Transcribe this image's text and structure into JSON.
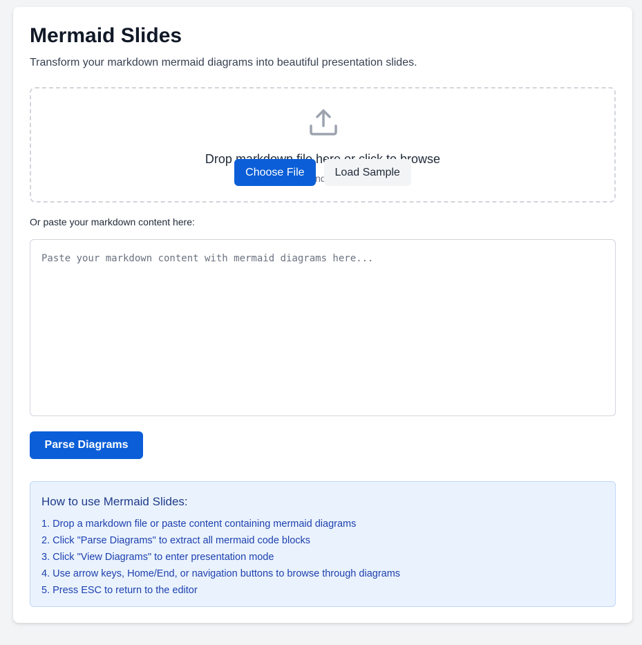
{
  "header": {
    "title": "Mermaid Slides",
    "subtitle": "Transform your markdown mermaid diagrams into beautiful presentation slides."
  },
  "dropzone": {
    "icon": "upload-icon",
    "text": "Drop markdown file here or click to browse",
    "hint": "Supports .md and .markdown files",
    "choose_file_label": "Choose File",
    "load_sample_label": "Load Sample"
  },
  "editor": {
    "label": "Or paste your markdown content here:",
    "value": "",
    "placeholder": "Paste your markdown content with mermaid diagrams here..."
  },
  "actions": {
    "parse_label": "Parse Diagrams"
  },
  "help": {
    "title": "How to use Mermaid Slides:",
    "steps": [
      "1. Drop a markdown file or paste content containing mermaid diagrams",
      "2. Click \"Parse Diagrams\" to extract all mermaid code blocks",
      "3. Click \"View Diagrams\" to enter presentation mode",
      "4. Use arrow keys, Home/End, or navigation buttons to browse through diagrams",
      "5. Press ESC to return to the editor"
    ]
  },
  "colors": {
    "primary": "#0b5ed7",
    "page_background": "#f3f4f6",
    "help_background": "#eaf3fd",
    "help_border": "#bfd6f6",
    "help_text": "#1e40af"
  }
}
